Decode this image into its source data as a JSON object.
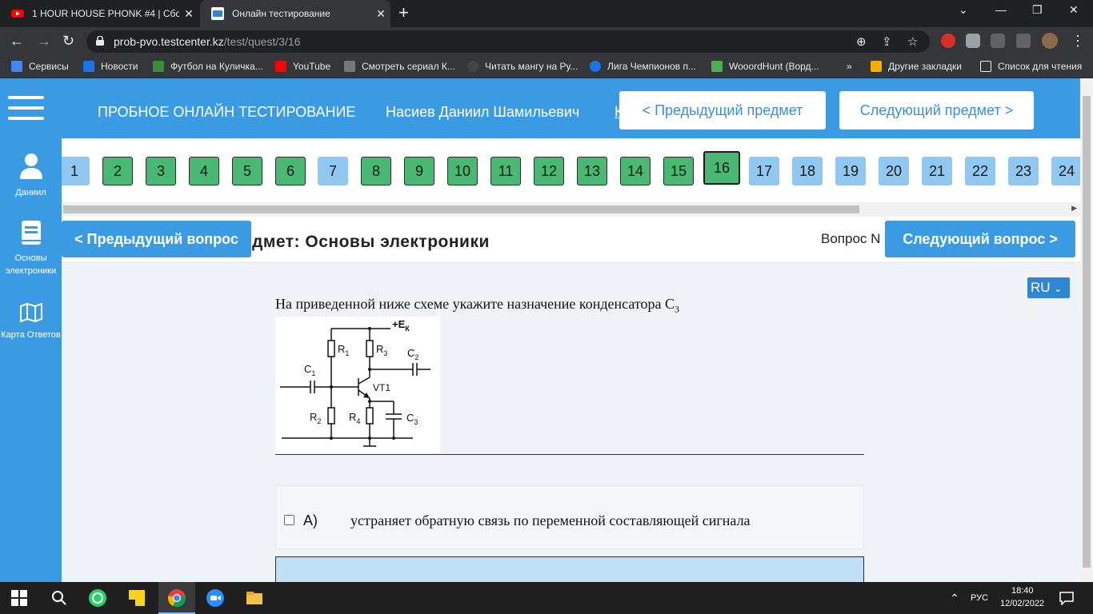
{
  "browser": {
    "tabs": [
      {
        "title": "1 HOUR HOUSE PHONK #4 | Сбо",
        "active": false,
        "favicon": "youtube-icon"
      },
      {
        "title": "Онлайн тестирование",
        "active": true,
        "favicon": "utc-icon"
      }
    ],
    "url_host": "prob-pvo.testcenter.kz",
    "url_path": "/test/quest/3/16",
    "bookmarks": [
      "Сервисы",
      "Новости",
      "Футбол на Куличка...",
      "YouTube",
      "Смотреть сериал К...",
      "Читать мангу на Ру...",
      "Лига Чемпионов п...",
      "WooordHunt (Ворд...",
      "»",
      "Другие закладки",
      "Список для чтения"
    ]
  },
  "header": {
    "title": "ПРОБНОЕ ОНЛАЙН ТЕСТИРОВАНИЕ",
    "user": "Насиев Даниил Шамильевич",
    "cut_link": "К",
    "prev_subject": "< Предыдущий предмет",
    "next_subject": "Следующий предмет >"
  },
  "sidebar": [
    {
      "label": "Даниил",
      "icon": "user-icon"
    },
    {
      "label": "Основы электроники",
      "icon": "book-icon"
    },
    {
      "label": "Карта Ответов",
      "icon": "map-icon"
    }
  ],
  "question_numbers": [
    {
      "n": "1",
      "state": "blue"
    },
    {
      "n": "2",
      "state": "green"
    },
    {
      "n": "3",
      "state": "green"
    },
    {
      "n": "4",
      "state": "green"
    },
    {
      "n": "5",
      "state": "green"
    },
    {
      "n": "6",
      "state": "green"
    },
    {
      "n": "7",
      "state": "blue"
    },
    {
      "n": "8",
      "state": "green"
    },
    {
      "n": "9",
      "state": "green"
    },
    {
      "n": "10",
      "state": "green"
    },
    {
      "n": "11",
      "state": "green"
    },
    {
      "n": "12",
      "state": "green"
    },
    {
      "n": "13",
      "state": "green"
    },
    {
      "n": "14",
      "state": "green"
    },
    {
      "n": "15",
      "state": "green"
    },
    {
      "n": "16",
      "state": "current"
    },
    {
      "n": "17",
      "state": "blue"
    },
    {
      "n": "18",
      "state": "blue"
    },
    {
      "n": "19",
      "state": "blue"
    },
    {
      "n": "20",
      "state": "blue"
    },
    {
      "n": "21",
      "state": "blue"
    },
    {
      "n": "22",
      "state": "blue"
    },
    {
      "n": "23",
      "state": "blue"
    },
    {
      "n": "24",
      "state": "blue"
    }
  ],
  "subheader": {
    "prev_question": "< Предыдущий вопрос",
    "subject": "дмет: Основы электроники",
    "question_label": "Вопрос N",
    "next_question": "Следующий вопрос >"
  },
  "language": "RU",
  "question": {
    "text": "На приведенной ниже схеме укажите назначение конденсатора С",
    "subscript": "3"
  },
  "schematic_labels": {
    "ek": "+E",
    "ek_sub": "К",
    "r1": "R",
    "r1_sub": "1",
    "r3": "R",
    "r3_sub": "3",
    "c2": "C",
    "c2_sub": "2",
    "c1": "C",
    "c1_sub": "1",
    "vt": "VT1",
    "r2": "R",
    "r2_sub": "2",
    "r4": "R",
    "r4_sub": "4",
    "c3": "C",
    "c3_sub": "3"
  },
  "answers": [
    {
      "letter": "A)",
      "text": "устраняет обратную связь по переменной составляющей сигнала",
      "checked": false
    }
  ],
  "taskbar": {
    "lang": "РУС",
    "time": "18:40",
    "date": "12/02/2022"
  },
  "colors": {
    "accent": "#3a9be3",
    "answered": "#48b872",
    "unanswered": "#90c8f0"
  }
}
